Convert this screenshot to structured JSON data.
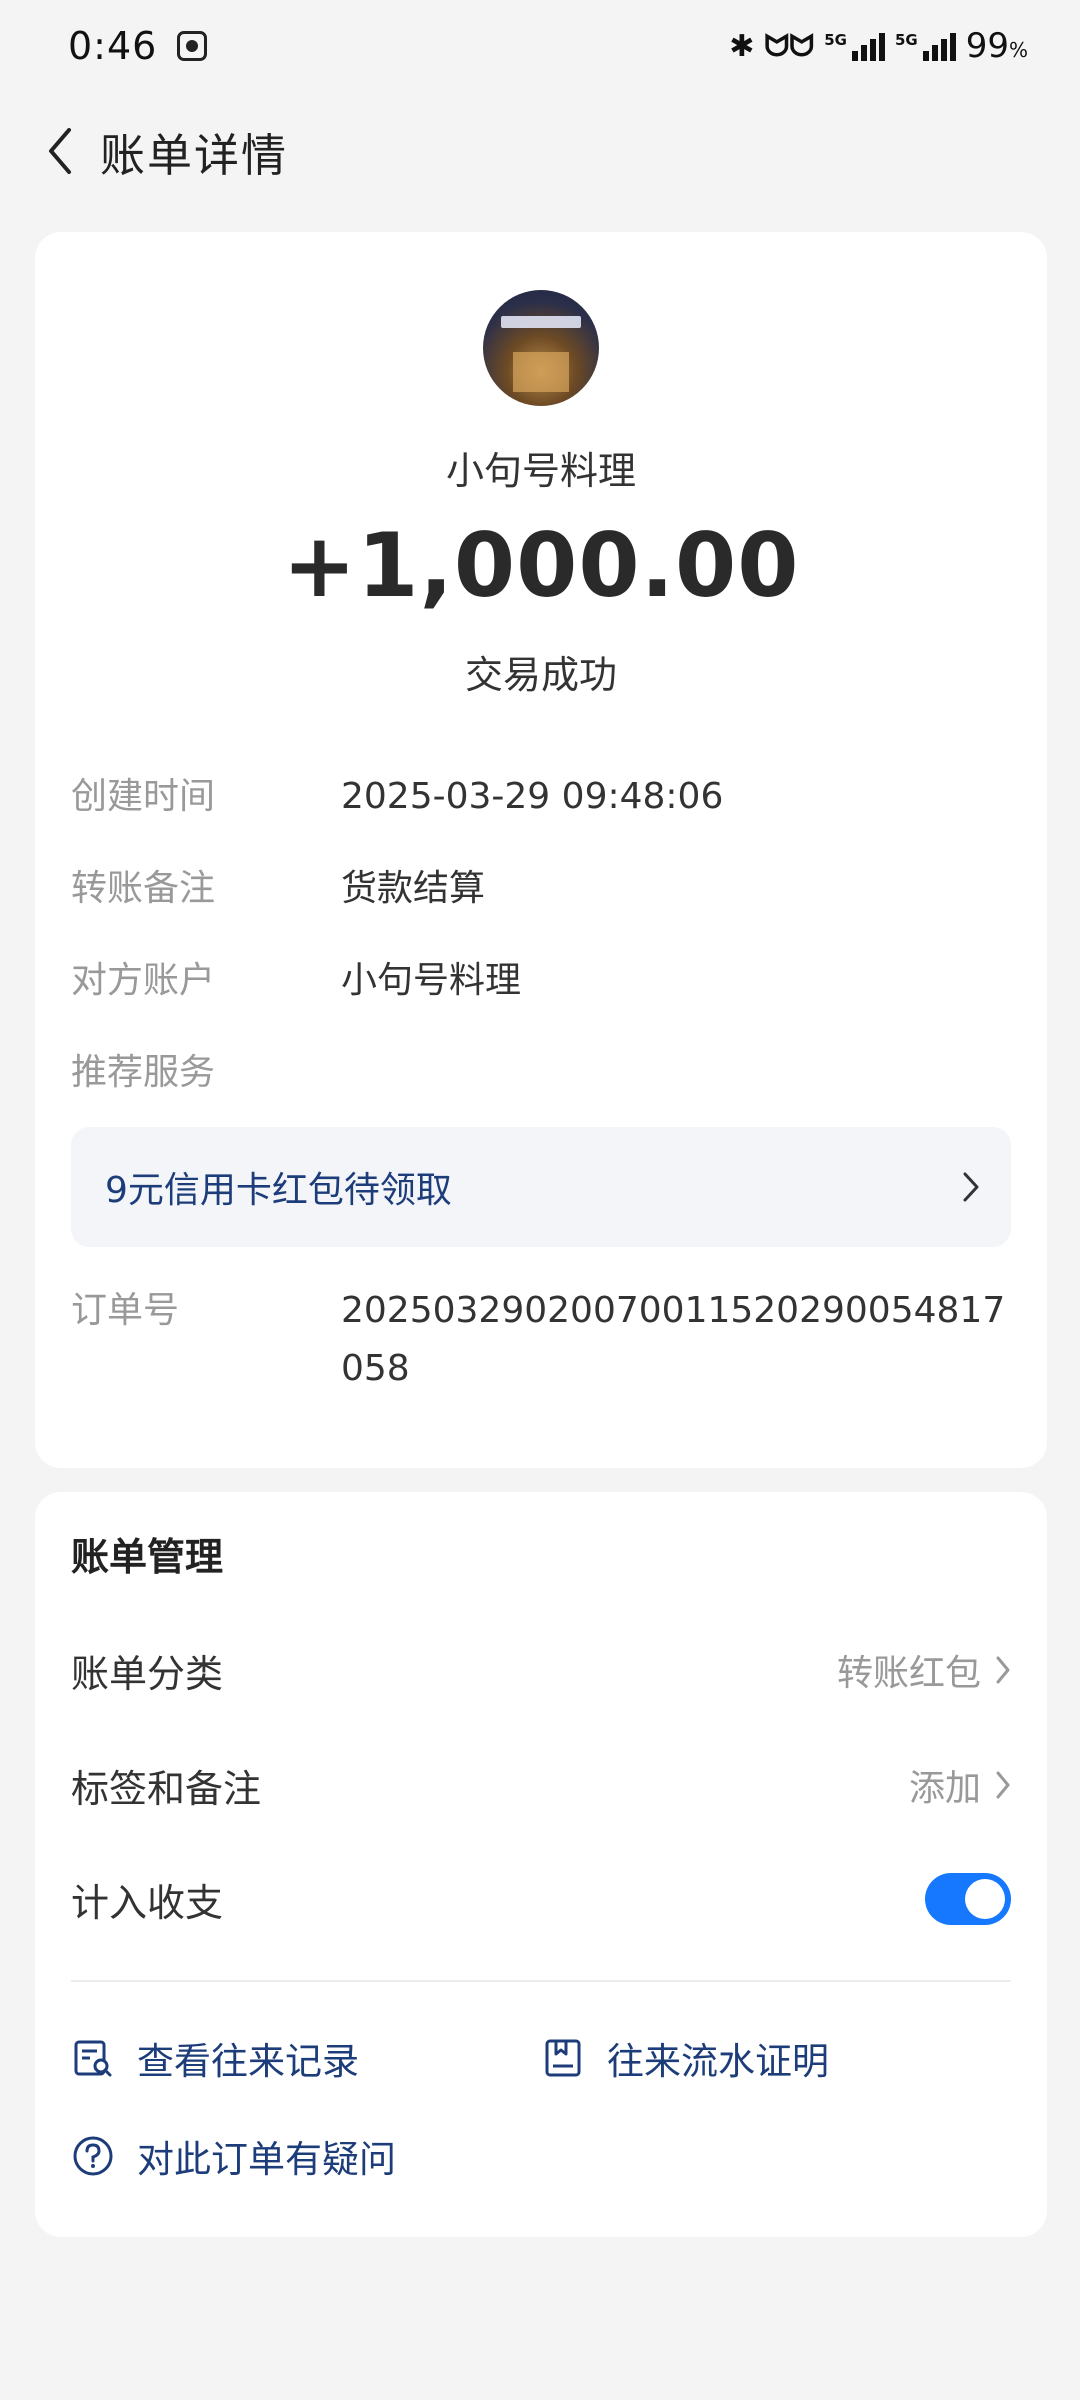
{
  "status_bar": {
    "time": "0:46",
    "network_1": "5G",
    "network_2": "5G",
    "battery": "99",
    "battery_unit": "%"
  },
  "header": {
    "title": "账单详情"
  },
  "detail": {
    "merchant_name": "小句号料理",
    "amount": "+1,000.00",
    "status": "交易成功",
    "rows": [
      {
        "label": "创建时间",
        "value": "2025-03-29 09:48:06"
      },
      {
        "label": "转账备注",
        "value": "货款结算"
      },
      {
        "label": "对方账户",
        "value": "小句号料理"
      },
      {
        "label": "推荐服务",
        "value": ""
      }
    ],
    "promo_text": "9元信用卡红包待领取",
    "order_label": "订单号",
    "order_number": "20250329020070011520290054817058"
  },
  "manage": {
    "title": "账单管理",
    "category_label": "账单分类",
    "category_value": "转账红包",
    "tags_label": "标签和备注",
    "tags_value": "添加",
    "include_label": "计入收支",
    "include_on": true,
    "links": {
      "history": "查看往来记录",
      "statement": "往来流水证明",
      "question": "对此订单有疑问"
    }
  },
  "colors": {
    "accent_blue": "#1677ff",
    "link_blue": "#1d3d7a",
    "background": "#f4f4f4"
  }
}
